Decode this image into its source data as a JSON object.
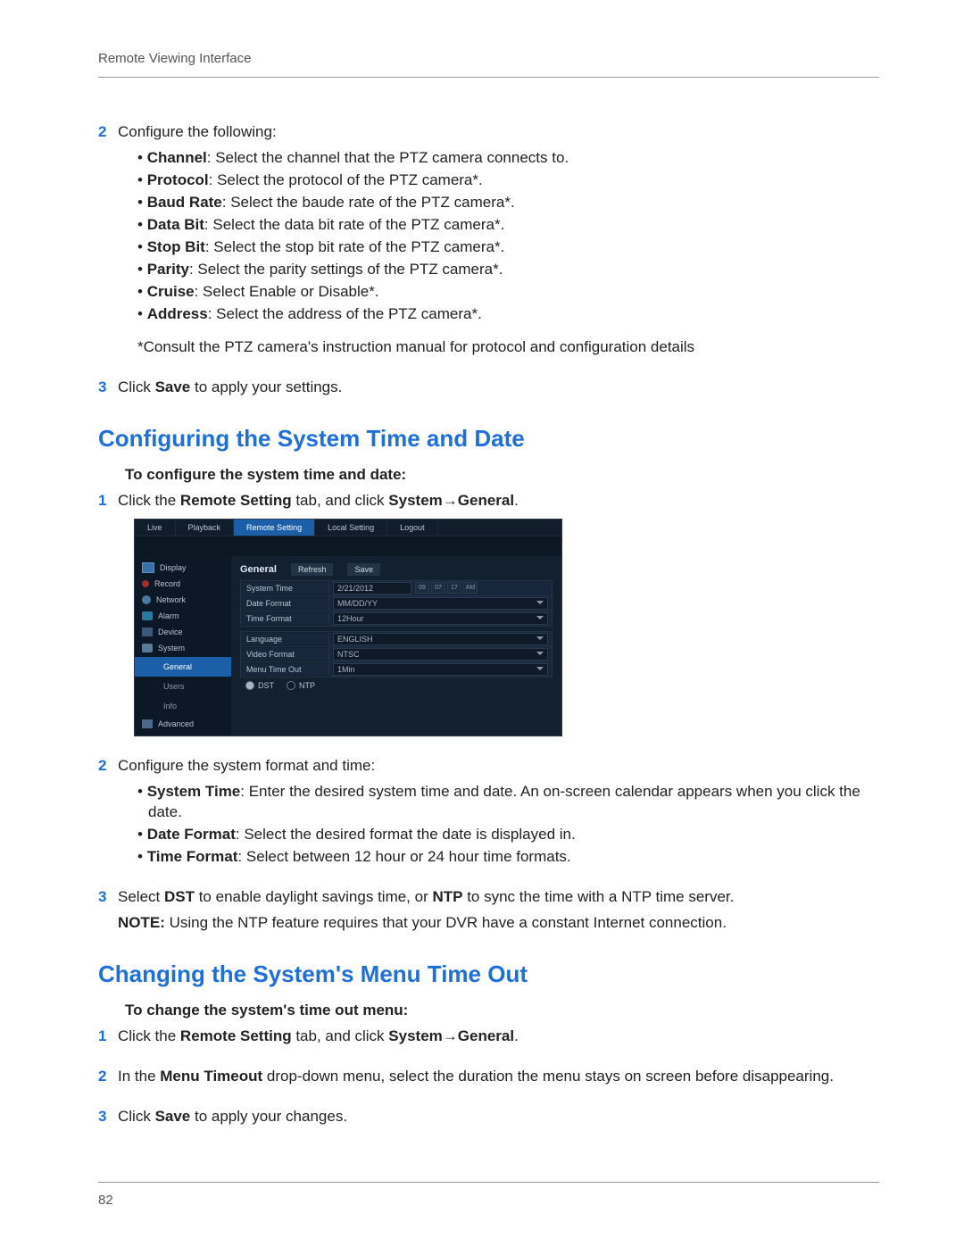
{
  "header": {
    "title": "Remote Viewing Interface"
  },
  "footer": {
    "page_number": "82"
  },
  "steps_ptz": {
    "n2": "2",
    "n3": "3",
    "intro2": "Configure the following:",
    "items": [
      {
        "label": "Channel",
        "text": ": Select the channel that the PTZ camera connects to."
      },
      {
        "label": "Protocol",
        "text": ": Select the protocol of the PTZ camera*."
      },
      {
        "label": "Baud Rate",
        "text": ": Select the baude rate of the PTZ camera*."
      },
      {
        "label": "Data Bit",
        "text": ": Select the data bit rate of the PTZ camera*."
      },
      {
        "label": "Stop Bit",
        "text": ": Select the stop bit rate of the PTZ camera*."
      },
      {
        "label": "Parity",
        "text": ": Select the parity settings of the PTZ camera*."
      },
      {
        "label": "Cruise",
        "text": ": Select Enable or Disable*."
      },
      {
        "label": "Address",
        "text": ": Select the address of the PTZ camera*."
      }
    ],
    "note": "*Consult the PTZ camera's instruction manual for protocol and configuration details",
    "step3_pre": "Click ",
    "step3_bold": "Save",
    "step3_post": " to apply your settings."
  },
  "section1": {
    "heading": "Configuring the System Time and Date",
    "proc_intro": "To configure the system time and date:",
    "n1": "1",
    "n2": "2",
    "n3": "3",
    "s1_pre": "Click the ",
    "s1_b1": "Remote Setting",
    "s1_mid": " tab, and click ",
    "s1_b2": "System",
    "arrow": "→",
    "s1_b3": "General",
    "s1_post": ".",
    "intro2": "Configure the system format and time:",
    "items": [
      {
        "label": "System Time",
        "text": ": Enter the desired system time and date. An on-screen calendar appears when you click the date."
      },
      {
        "label": "Date Format",
        "text": ": Select the desired format the date is displayed in."
      },
      {
        "label": "Time Format",
        "text": ": Select between 12 hour or 24 hour time formats."
      }
    ],
    "s3_pre": "Select ",
    "s3_b1": "DST",
    "s3_mid": " to enable daylight savings time, or ",
    "s3_b2": "NTP",
    "s3_post": " to sync the time with a NTP time server.",
    "note_b": "NOTE:",
    "note_text": " Using the NTP feature requires that your DVR have a constant Internet connection."
  },
  "section2": {
    "heading": "Changing the System's Menu Time Out",
    "proc_intro": "To change the system's time out menu:",
    "n1": "1",
    "n2": "2",
    "n3": "3",
    "s1_pre": "Click the ",
    "s1_b1": "Remote Setting",
    "s1_mid": " tab, and click ",
    "s1_b2": "System",
    "arrow": "→",
    "s1_b3": "General",
    "s1_post": ".",
    "s2_pre": "In the ",
    "s2_b": "Menu Timeout",
    "s2_post": " drop-down menu, select the duration the menu stays on screen before disappearing.",
    "s3_pre": "Click ",
    "s3_b": "Save",
    "s3_post": " to apply your changes."
  },
  "dvr": {
    "tabs": [
      "Live",
      "Playback",
      "Remote Setting",
      "Local Setting",
      "Logout"
    ],
    "active_tab": 2,
    "side": [
      {
        "label": "Display",
        "icon": "ic-display"
      },
      {
        "label": "Record",
        "icon": "ic-record"
      },
      {
        "label": "Network",
        "icon": "ic-network"
      },
      {
        "label": "Alarm",
        "icon": "ic-alarm"
      },
      {
        "label": "Device",
        "icon": "ic-device"
      },
      {
        "label": "System",
        "icon": "ic-system",
        "subs": [
          "General",
          "Users",
          "Info"
        ],
        "selected_sub": 0
      },
      {
        "label": "Advanced",
        "icon": "ic-adv"
      }
    ],
    "panel": {
      "title": "General",
      "btn_refresh": "Refresh",
      "btn_save": "Save",
      "rows1": [
        {
          "label": "System Time",
          "value": "2/21/2012",
          "type": "date"
        },
        {
          "label": "Date Format",
          "value": "MM/DD/YY",
          "type": "select"
        },
        {
          "label": "Time Format",
          "value": "12Hour",
          "type": "select"
        }
      ],
      "rows2": [
        {
          "label": "Language",
          "value": "ENGLISH",
          "type": "select"
        },
        {
          "label": "Video Format",
          "value": "NTSC",
          "type": "select"
        },
        {
          "label": "Menu Time Out",
          "value": "1Min",
          "type": "select"
        }
      ],
      "radio_dst": "DST",
      "radio_ntp": "NTP",
      "time_segments": [
        "09",
        "07",
        "17",
        "AM"
      ]
    }
  }
}
